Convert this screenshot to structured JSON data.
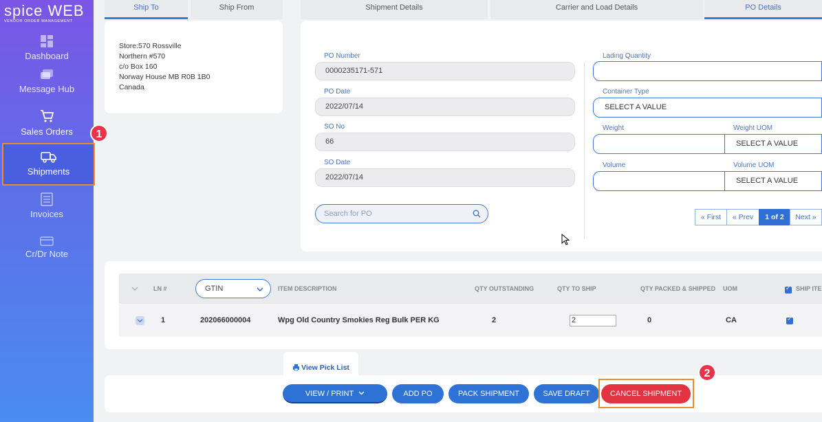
{
  "brand": {
    "name": "spice WEB",
    "tagline": "VENDOR ORDER MANAGEMENT"
  },
  "sidebar": {
    "items": [
      {
        "label": "Dashboard",
        "icon": "dashboard-icon"
      },
      {
        "label": "Message Hub",
        "icon": "chat-icon"
      },
      {
        "label": "Sales Orders",
        "icon": "cart-icon"
      },
      {
        "label": "Shipments",
        "icon": "truck-icon",
        "active": true
      },
      {
        "label": "Invoices",
        "icon": "invoice-icon"
      },
      {
        "label": "Cr/Dr Note",
        "icon": "card-icon"
      }
    ]
  },
  "callouts": {
    "one": "1",
    "two": "2"
  },
  "tabs": [
    "Ship To",
    "Ship From",
    "Shipment Details",
    "Carrier and Load Details",
    "PO Details"
  ],
  "ship_to": {
    "lines": [
      "Store:570 Rossville",
      "Northern #570",
      "c/o Box 160",
      "Norway House MB R0B 1B0",
      "Canada"
    ]
  },
  "po": {
    "po_number_label": "PO Number",
    "po_number": "0000235171-571",
    "po_date_label": "PO Date",
    "po_date": "2022/07/14",
    "so_no_label": "SO No",
    "so_no": "66",
    "so_date_label": "SO Date",
    "so_date": "2022/07/14",
    "search_placeholder": "Search for PO"
  },
  "load": {
    "lading_qty_label": "Lading Quantity",
    "container_type_label": "Container Type",
    "container_type_value": "SELECT A VALUE",
    "weight_label": "Weight",
    "weight_uom_label": "Weight UOM",
    "weight_uom_value": "SELECT A VALUE",
    "volume_label": "Volume",
    "volume_uom_label": "Volume UOM",
    "volume_uom_value": "SELECT A VALUE"
  },
  "pager": {
    "first": "« First",
    "prev": "« Prev",
    "current": "1 of 2",
    "next": "Next »"
  },
  "table": {
    "headers": {
      "ln": "LN #",
      "gtin": "GTIN",
      "desc": "ITEM DESCRIPTION",
      "qty_out": "QTY OUTSTANDING",
      "qty_ship": "QTY TO SHIP",
      "qty_packed": "QTY PACKED & SHIPPED",
      "uom": "UOM",
      "ship_item": "SHIP ITEM"
    },
    "rows": [
      {
        "ln": "1",
        "gtin": "202066000004",
        "desc": "Wpg Old Country Smokies Reg Bulk PER KG",
        "qty_out": "2",
        "qty_ship": "2",
        "qty_packed": "0",
        "uom": "CA"
      }
    ]
  },
  "actions": {
    "view_pick_list": "View Pick List",
    "view_print": "VIEW / PRINT",
    "add_po": "ADD PO",
    "pack_shipment": "PACK SHIPMENT",
    "save_draft": "SAVE DRAFT",
    "cancel_shipment": "CANCEL SHIPMENT"
  }
}
